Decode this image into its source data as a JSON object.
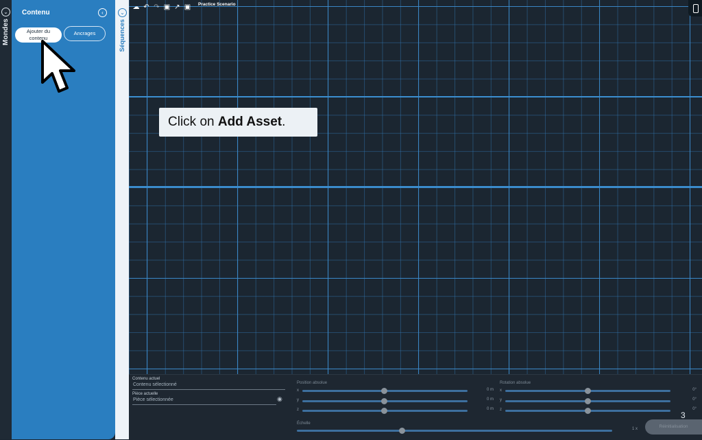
{
  "worlds_panel": {
    "label": "Mondes"
  },
  "content_panel": {
    "title": "Contenu",
    "add_asset_label_line1": "Ajouter du",
    "add_asset_label_line2": "contenu",
    "anchors_label": "Ancrages"
  },
  "sequences_panel": {
    "label": "Séquences"
  },
  "toolbar": {
    "scenario_title": "Practice Scenario",
    "icons": [
      "cloud-save-icon",
      "undo-icon",
      "redo-icon",
      "focus-icon",
      "export-icon",
      "camera-icon"
    ]
  },
  "tooltip": {
    "prefix": "Click on ",
    "bold": "Add Asset",
    "suffix": "."
  },
  "properties": {
    "current_asset_label": "Contenu actuel",
    "current_asset_value": "Contenu sélectionné",
    "current_part_label": "Pièce actuelle",
    "current_part_value": "Pièce sélectionnée",
    "position_label": "Position absolue",
    "rotation_label": "Rotation absolue",
    "scale_label": "Échelle",
    "axes": [
      "x",
      "y",
      "z"
    ],
    "position_values": [
      "0 m",
      "0 m",
      "0 m"
    ],
    "rotation_values": [
      "0°",
      "0°",
      "0°"
    ],
    "scale_value": "1 x",
    "reset_label": "Réinitialisation"
  },
  "page_number": "3",
  "colors": {
    "panel_blue": "#2a7ec0",
    "grid_major": "#3c8ccd",
    "background": "#1b2631"
  }
}
